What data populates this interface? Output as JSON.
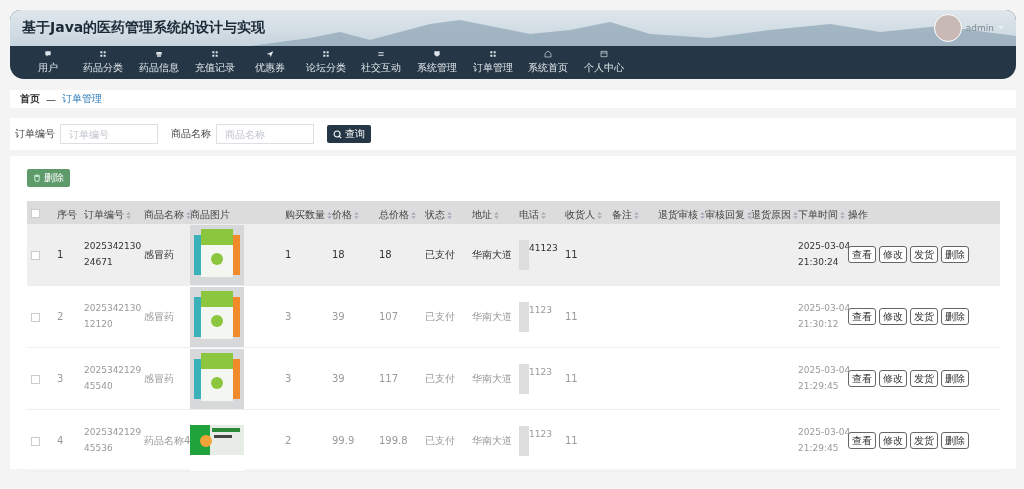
{
  "header": {
    "title": "基于Java的医药管理系统的设计与实现",
    "user": "admin"
  },
  "nav": [
    {
      "label": "用户"
    },
    {
      "label": "药品分类"
    },
    {
      "label": "药品信息"
    },
    {
      "label": "充值记录"
    },
    {
      "label": "优惠券"
    },
    {
      "label": "论坛分类"
    },
    {
      "label": "社交互动"
    },
    {
      "label": "系统管理"
    },
    {
      "label": "订单管理"
    },
    {
      "label": "系统首页"
    },
    {
      "label": "个人中心"
    }
  ],
  "breadcrumb": {
    "home": "首页",
    "separator": "—",
    "current": "订单管理"
  },
  "search": {
    "fields": [
      {
        "label": "订单编号",
        "placeholder": "订单编号"
      },
      {
        "label": "商品名称",
        "placeholder": "商品名称"
      }
    ],
    "button": "查询"
  },
  "delete_button": "删除",
  "table": {
    "select_all_checked": false,
    "columns": [
      {
        "label": "序号",
        "sortable": false
      },
      {
        "label": "订单编号",
        "sortable": true
      },
      {
        "label": "商品名称",
        "sortable": true
      },
      {
        "label": "商品图片",
        "sortable": false
      },
      {
        "label": "购买数量",
        "sortable": true
      },
      {
        "label": "价格",
        "sortable": true
      },
      {
        "label": "总价格",
        "sortable": true
      },
      {
        "label": "状态",
        "sortable": true
      },
      {
        "label": "地址",
        "sortable": true
      },
      {
        "label": "电话",
        "sortable": true
      },
      {
        "label": "收货人",
        "sortable": true
      },
      {
        "label": "备注",
        "sortable": true
      },
      {
        "label": "退货审核",
        "sortable": true
      },
      {
        "label": "审核回复",
        "sortable": true
      },
      {
        "label": "退货原因",
        "sortable": true
      },
      {
        "label": "下单时间",
        "sortable": true
      },
      {
        "label": "操作",
        "sortable": false
      }
    ],
    "rows": [
      {
        "highlighted": true,
        "checked": false,
        "index": "1",
        "order_no": "202534213024671",
        "product": "感冒药",
        "kind": "pouch",
        "quantity": "1",
        "price": "18",
        "total": "18",
        "status": "已支付",
        "address": "华南大道",
        "phone": "41123",
        "receiver": "11",
        "date": "2025-03-04",
        "time": "21:30:24",
        "actions": [
          "查看",
          "修改",
          "发货",
          "删除"
        ]
      },
      {
        "highlighted": false,
        "checked": false,
        "index": "2",
        "order_no": "202534213012120",
        "product": "感冒药",
        "kind": "pouch",
        "quantity": "3",
        "price": "39",
        "total": "107",
        "status": "已支付",
        "address": "华南大道",
        "phone": "1123",
        "receiver": "11",
        "date": "2025-03-04",
        "time": "21:30:12",
        "actions": [
          "查看",
          "修改",
          "发货",
          "删除"
        ]
      },
      {
        "highlighted": false,
        "checked": false,
        "index": "3",
        "order_no": "202534212945540",
        "product": "感冒药",
        "kind": "pouch",
        "quantity": "3",
        "price": "39",
        "total": "117",
        "status": "已支付",
        "address": "华南大道",
        "phone": "1123",
        "receiver": "11",
        "date": "2025-03-04",
        "time": "21:29:45",
        "actions": [
          "查看",
          "修改",
          "发货",
          "删除"
        ]
      },
      {
        "highlighted": false,
        "checked": false,
        "index": "4",
        "order_no": "202534212945536",
        "product": "药品名称4",
        "kind": "carton",
        "quantity": "2",
        "price": "99.9",
        "total": "199.8",
        "status": "已支付",
        "address": "华南大道",
        "phone": "1123",
        "receiver": "11",
        "date": "2025-03-04",
        "time": "21:29:45",
        "actions": [
          "查看",
          "修改",
          "发货",
          "删除"
        ]
      }
    ]
  }
}
